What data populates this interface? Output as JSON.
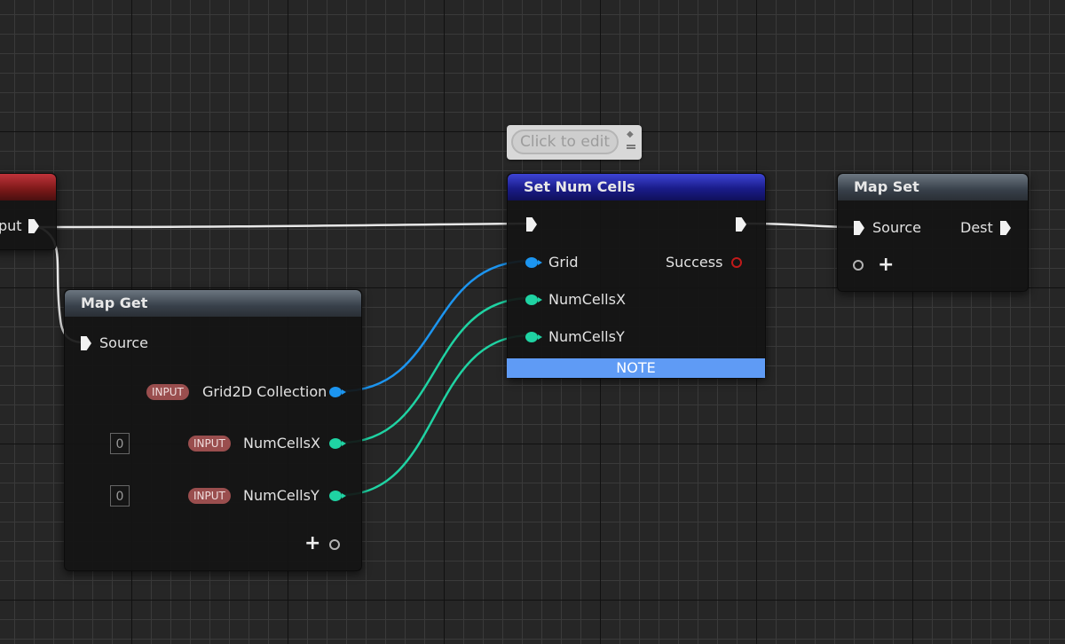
{
  "left_node": {
    "partial_label": "put"
  },
  "map_get": {
    "title": "Map Get",
    "source_label": "Source",
    "input_badge": "INPUT",
    "grid_label": "Grid2D Collection",
    "cellsx_label": "NumCellsX",
    "cellsy_label": "NumCellsY",
    "cellsx_default": "0",
    "cellsy_default": "0",
    "add_pin": "+"
  },
  "set_num_cells": {
    "title": "Set Num Cells",
    "grid_label": "Grid",
    "success_label": "Success",
    "cellsx_label": "NumCellsX",
    "cellsy_label": "NumCellsY",
    "note_label": "NOTE"
  },
  "comment_bubble": {
    "text": "Click to edit"
  },
  "map_set": {
    "title": "Map Set",
    "source_label": "Source",
    "dest_label": "Dest",
    "add_pin": "+"
  },
  "colors": {
    "exec_wire": "#e8e8e8",
    "grid_wire": "#1c95f0",
    "int_wire": "#1fd3a3",
    "success_pin": "#c01a1a"
  }
}
